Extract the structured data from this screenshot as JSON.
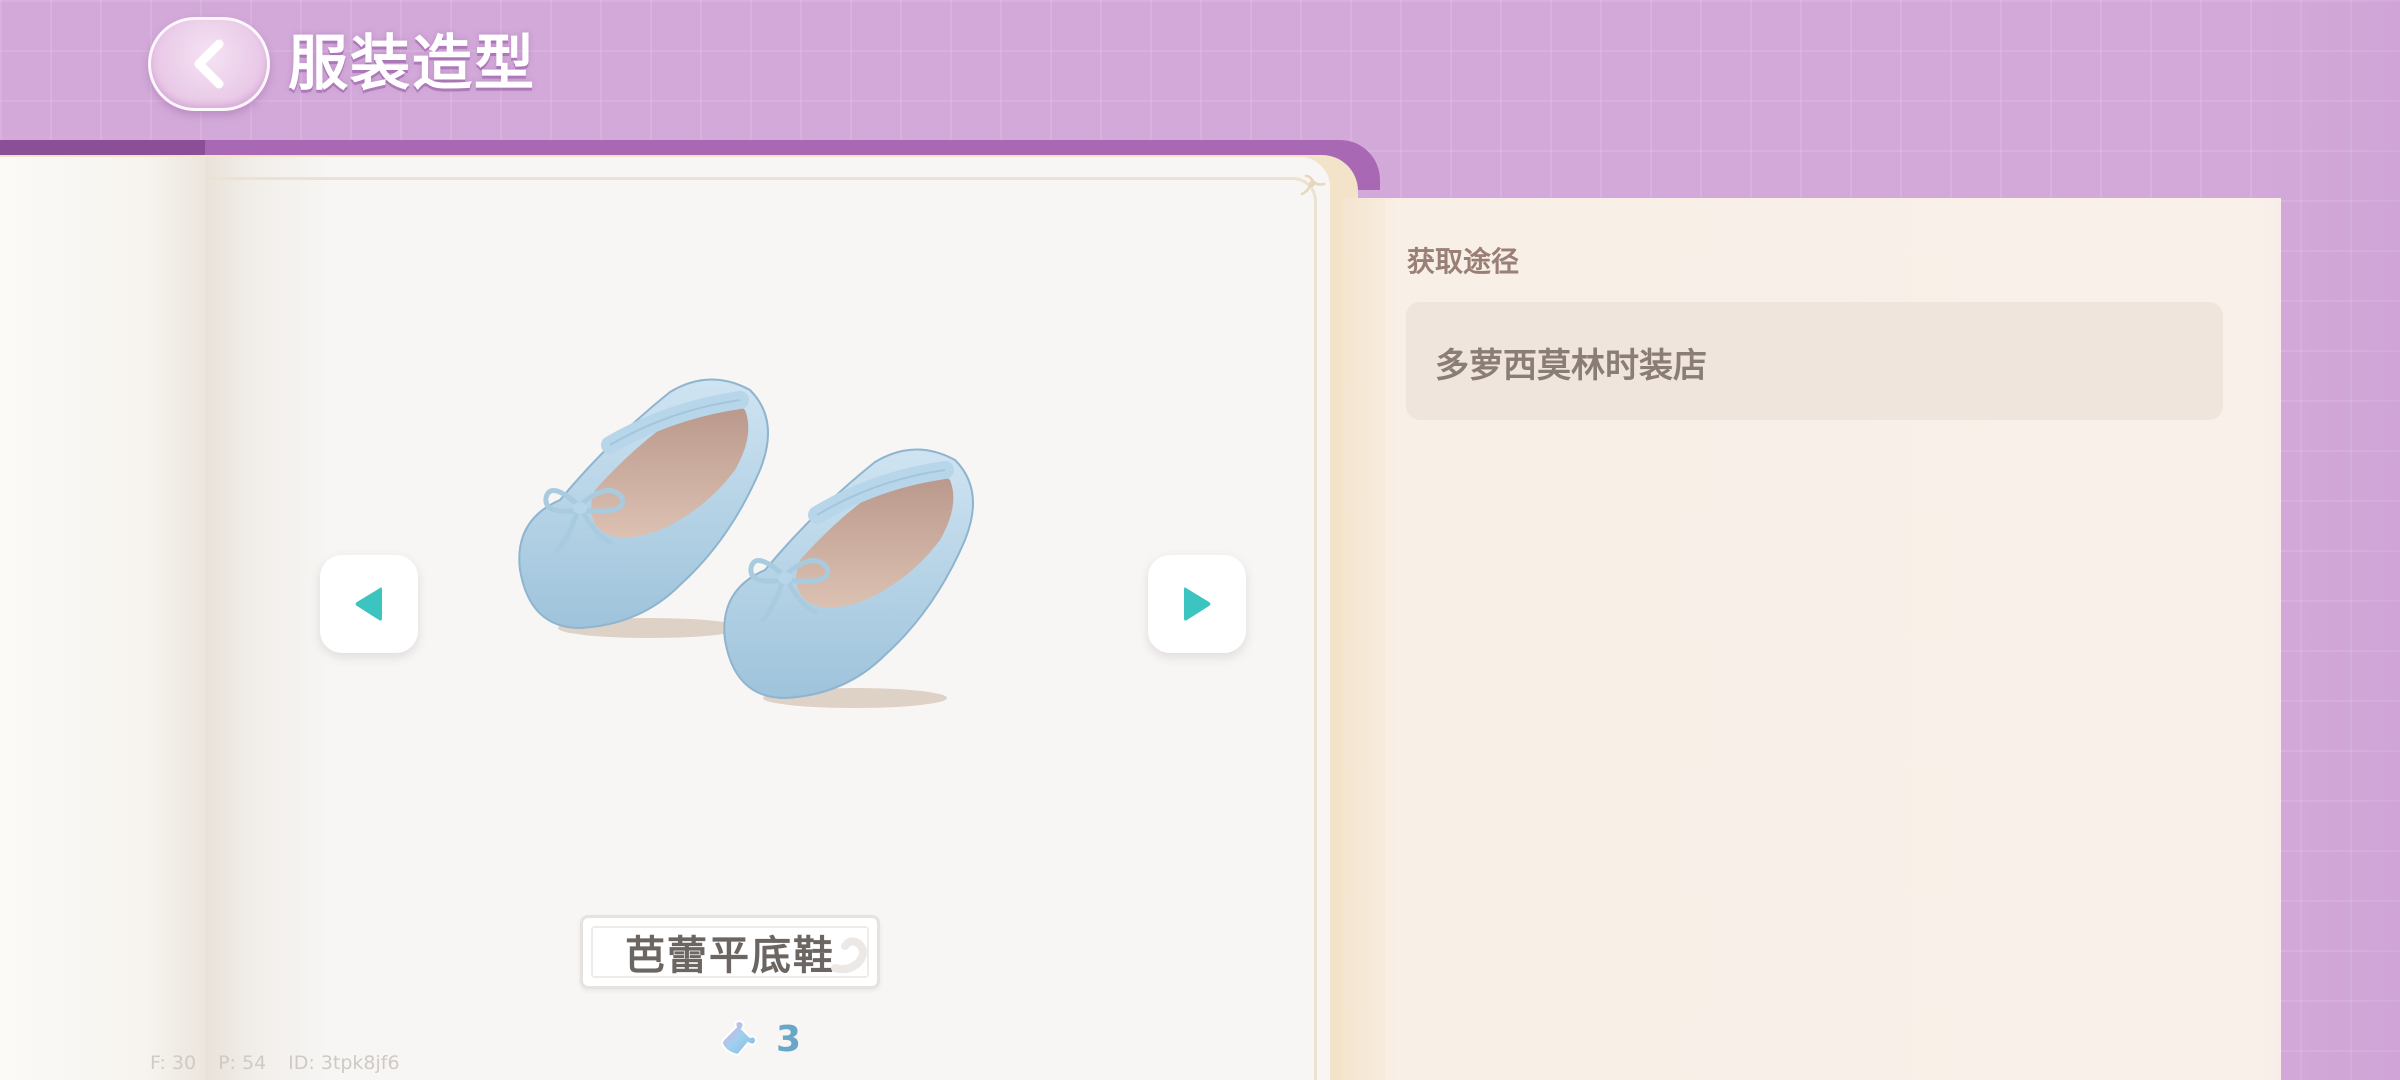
{
  "header": {
    "title": "服装造型"
  },
  "item": {
    "name": "芭蕾平底鞋",
    "count": "3"
  },
  "acquisition": {
    "heading": "获取途径",
    "source": "多萝西莫林时装店"
  },
  "debug": {
    "fps": "F: 30",
    "ping": "P: 54",
    "id": "ID: 3tpk8jf6"
  },
  "icons": {
    "back": "chevron-left-icon",
    "prev": "triangle-left-icon",
    "next": "triangle-right-icon",
    "count": "puzzle-piece-icon"
  },
  "colors": {
    "background": "#d2a9d8",
    "book_trim": "#a868b3",
    "arrow_teal": "#3cc4c0",
    "count_blue": "#69a7c9"
  }
}
